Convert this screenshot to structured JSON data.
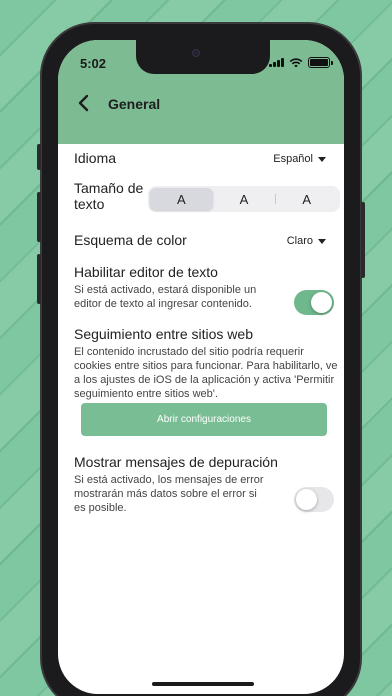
{
  "status_bar": {
    "time": "5:02"
  },
  "nav": {
    "title": "General"
  },
  "settings": {
    "language": {
      "label": "Idioma",
      "value": "Español"
    },
    "text_size": {
      "label": "Tamaño de texto",
      "options": [
        "A",
        "A",
        "A"
      ],
      "selected_index": 0
    },
    "color_scheme": {
      "label": "Esquema de color",
      "value": "Claro"
    },
    "text_editor": {
      "label": "Habilitar editor de texto",
      "description": "Si está activado, estará disponible un editor de texto al ingresar contenido.",
      "enabled": true
    },
    "cross_site": {
      "label": "Seguimiento entre sitios web",
      "description": "El contenido incrustado del sitio podría requerir cookies entre sitios para funcionar. Para habilitarlo, ve a los ajustes de iOS de la aplicación y activa 'Permitir seguimiento entre sitios web'.",
      "button_label": "Abrir configuraciones"
    },
    "debug": {
      "label": "Mostrar mensajes de depuración",
      "description": "Si está activado, los mensajes de error mostrarán más datos sobre el error si es posible.",
      "enabled": false
    }
  },
  "colors": {
    "header": "#7dbb93",
    "accent": "#6fb78d",
    "background": "#78c29b"
  }
}
